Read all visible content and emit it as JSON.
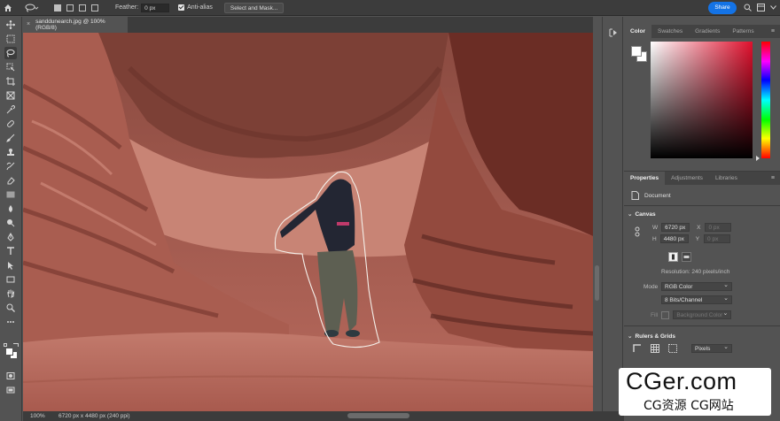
{
  "options_bar": {
    "feather_label": "Feather:",
    "feather_value": "0 px",
    "anti_alias_label": "Anti-alias",
    "select_mask_label": "Select and Mask..."
  },
  "header": {
    "share_label": "Share"
  },
  "document": {
    "tab_title": "sanddunearch.jpg @ 100% (RGB/8)",
    "close_glyph": "×"
  },
  "color_panel": {
    "tabs": [
      "Color",
      "Swatches",
      "Gradients",
      "Patterns"
    ],
    "active_tab": "Color",
    "foreground": "#ffffff",
    "background": "#ffffff",
    "hue_color": "#e0102d"
  },
  "properties_panel": {
    "tabs": [
      "Properties",
      "Adjustments",
      "Libraries"
    ],
    "active_tab": "Properties",
    "document_label": "Document",
    "canvas_section": "Canvas",
    "width_label": "W",
    "width_value": "6720 px",
    "height_label": "H",
    "height_value": "4480 px",
    "x_label": "X",
    "x_value": "0 px",
    "y_label": "Y",
    "y_value": "0 px",
    "resolution": "Resolution: 240 pixels/inch",
    "mode_label": "Mode",
    "mode_value": "RGB Color",
    "bits_value": "8 Bits/Channel",
    "fill_label": "Fill",
    "fill_value": "Background Color",
    "rulers_section": "Rulers & Grids",
    "units_value": "Pixels"
  },
  "status_bar": {
    "zoom": "100%",
    "doc_info": "6720 px x 4480 px (240 ppi)"
  },
  "watermark": {
    "main": "CGer.com",
    "sub": "CG资源 CG网站"
  }
}
